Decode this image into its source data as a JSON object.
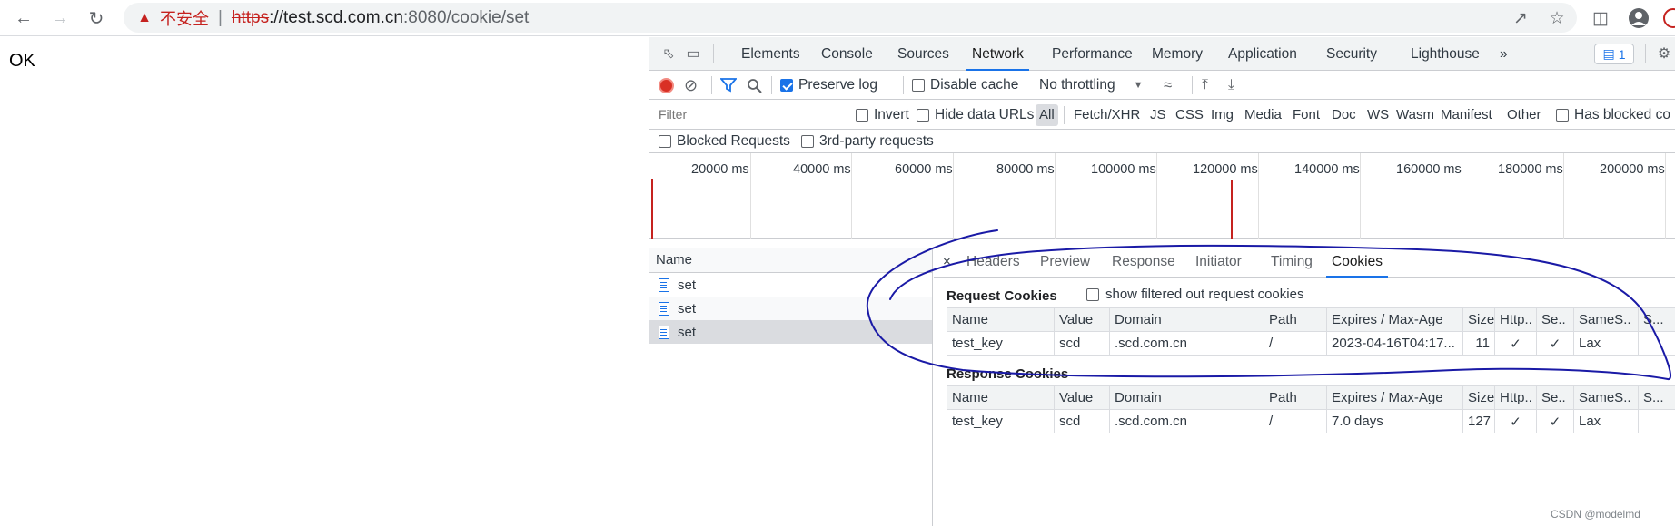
{
  "browser": {
    "security_label": "不安全",
    "url_scheme": "https",
    "url_host": "://test.scd.com.cn",
    "url_rest": ":8080/cookie/set"
  },
  "page": {
    "body_text": "OK"
  },
  "devtools": {
    "tabs": [
      "Elements",
      "Console",
      "Sources",
      "Network",
      "Performance",
      "Memory",
      "Application",
      "Security",
      "Lighthouse"
    ],
    "active_tab": "Network",
    "more_tabs": "»",
    "issues_count": "1",
    "toolbar": {
      "preserve_log": "Preserve log",
      "disable_cache": "Disable cache",
      "throttling": "No throttling"
    },
    "filter_bar": {
      "placeholder": "Filter",
      "invert": "Invert",
      "hide_data_urls": "Hide data URLs",
      "types": [
        "All",
        "Fetch/XHR",
        "JS",
        "CSS",
        "Img",
        "Media",
        "Font",
        "Doc",
        "WS",
        "Wasm",
        "Manifest",
        "Other"
      ],
      "has_blocked": "Has blocked co"
    },
    "filter_bar2": {
      "blocked_requests": "Blocked Requests",
      "third_party": "3rd-party requests"
    },
    "timeline_ticks": [
      "20000 ms",
      "40000 ms",
      "60000 ms",
      "80000 ms",
      "100000 ms",
      "120000 ms",
      "140000 ms",
      "160000 ms",
      "180000 ms",
      "200000 ms"
    ],
    "requests": {
      "header": "Name",
      "rows": [
        "set",
        "set",
        "set"
      ],
      "selected_index": 2
    },
    "detail": {
      "close": "×",
      "tabs": [
        "Headers",
        "Preview",
        "Response",
        "Initiator",
        "Timing",
        "Cookies"
      ],
      "active_tab": "Cookies",
      "request_cookies_title": "Request Cookies",
      "show_filtered": "show filtered out request cookies",
      "response_cookies_title": "Response Cookies",
      "columns": [
        "Name",
        "Value",
        "Domain",
        "Path",
        "Expires / Max-Age",
        "Size",
        "Http..",
        "Se..",
        "SameS..",
        "S..."
      ],
      "request_rows": [
        [
          "test_key",
          "scd",
          ".scd.com.cn",
          "/",
          "2023-04-16T04:17...",
          "11",
          "✓",
          "✓",
          "Lax",
          ""
        ]
      ],
      "response_rows": [
        [
          "test_key",
          "scd",
          ".scd.com.cn",
          "/",
          "7.0 days",
          "127",
          "✓",
          "✓",
          "Lax",
          ""
        ]
      ]
    }
  },
  "watermark": "CSDN @modelmd",
  "colors": {
    "accent": "#1a73e8",
    "record": "#d93025",
    "annotation": "#1a1aa6"
  }
}
